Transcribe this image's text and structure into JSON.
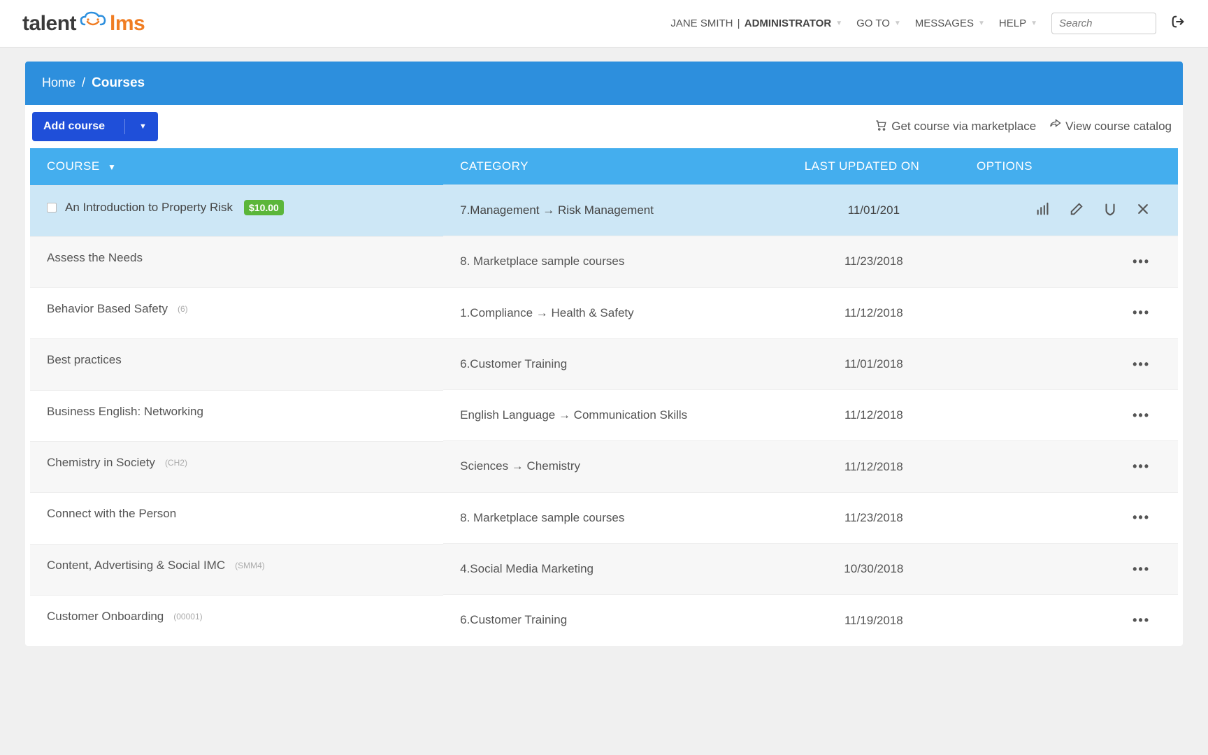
{
  "header": {
    "logo_talent": "talent",
    "logo_lms": "lms",
    "user_name": "JANE SMITH",
    "user_role": "ADMINISTRATOR",
    "nav_goto": "GO TO",
    "nav_messages": "MESSAGES",
    "nav_help": "HELP",
    "search_placeholder": "Search"
  },
  "breadcrumb": {
    "home": "Home",
    "sep": "/",
    "current": "Courses"
  },
  "toolbar": {
    "add_course": "Add course",
    "marketplace": "Get course via marketplace",
    "catalog": "View course catalog"
  },
  "table": {
    "headers": {
      "course": "COURSE",
      "category": "CATEGORY",
      "updated": "LAST UPDATED ON",
      "options": "OPTIONS"
    },
    "rows": [
      {
        "course": "An Introduction to Property Risk",
        "price": "$10.00",
        "category": "7.Management → Risk Management",
        "date": "11/01/201",
        "selected": true
      },
      {
        "course": "Assess the Needs",
        "category": "8. Marketplace sample courses",
        "date": "11/23/2018"
      },
      {
        "course": "Behavior Based Safety",
        "code": "(6)",
        "category": "1.Compliance → Health & Safety",
        "date": "11/12/2018"
      },
      {
        "course": "Best practices",
        "category": "6.Customer Training",
        "date": "11/01/2018"
      },
      {
        "course": "Business English: Networking",
        "category": "English Language → Communication Skills",
        "date": "11/12/2018"
      },
      {
        "course": "Chemistry in Society",
        "code": "(CH2)",
        "category": "Sciences → Chemistry",
        "date": "11/12/2018"
      },
      {
        "course": "Connect with the Person",
        "category": "8. Marketplace sample courses",
        "date": "11/23/2018"
      },
      {
        "course": "Content, Advertising & Social IMC",
        "code": "(SMM4)",
        "category": "4.Social Media Marketing",
        "date": "10/30/2018"
      },
      {
        "course": "Customer Onboarding",
        "code": "(00001)",
        "category": "6.Customer Training",
        "date": "11/19/2018"
      }
    ]
  }
}
